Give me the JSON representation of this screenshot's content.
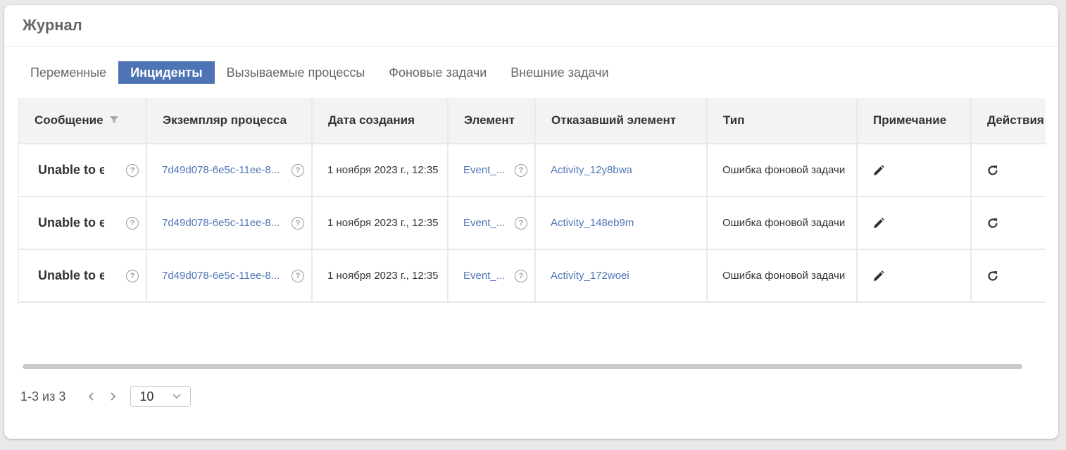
{
  "panel": {
    "title": "Журнал"
  },
  "tabs": [
    {
      "label": "Переменные",
      "active": false
    },
    {
      "label": "Инциденты",
      "active": true
    },
    {
      "label": "Вызываемые процессы",
      "active": false
    },
    {
      "label": "Фоновые задачи",
      "active": false
    },
    {
      "label": "Внешние задачи",
      "active": false
    }
  ],
  "table": {
    "columns": [
      "Сообщение",
      "Экземпляр процесса",
      "Дата создания",
      "Элемент",
      "Отказавший элемент",
      "Тип",
      "Примечание",
      "Действия"
    ],
    "rows": [
      {
        "message": "Unable to e",
        "instance": "7d49d078-6e5c-11ee-8...",
        "created": "1 ноября 2023 г., 12:35",
        "element": "Event_...",
        "failed_element": "Activity_12y8bwa",
        "type": "Ошибка фоновой задачи"
      },
      {
        "message": "Unable to e",
        "instance": "7d49d078-6e5c-11ee-8...",
        "created": "1 ноября 2023 г., 12:35",
        "element": "Event_...",
        "failed_element": "Activity_148eb9m",
        "type": "Ошибка фоновой задачи"
      },
      {
        "message": "Unable to e",
        "instance": "7d49d078-6e5c-11ee-8...",
        "created": "1 ноября 2023 г., 12:35",
        "element": "Event_...",
        "failed_element": "Activity_172woei",
        "type": "Ошибка фоновой задачи"
      }
    ]
  },
  "pagination": {
    "summary": "1-3 из 3",
    "page_size": "10"
  },
  "icons": {
    "help": "question-circle-icon",
    "filter": "filter-icon",
    "edit": "pencil-icon",
    "retry": "refresh-icon",
    "prev": "chevron-left-icon",
    "next": "chevron-right-icon",
    "dropdown": "chevron-down-icon"
  },
  "colors": {
    "accent": "#4f74b6",
    "header_bg": "#f3f3f3",
    "border": "#e9e9e9"
  }
}
